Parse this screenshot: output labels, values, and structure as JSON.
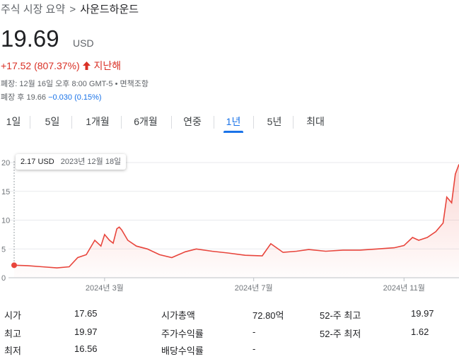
{
  "breadcrumb": {
    "root": "주식 시장 요약",
    "separator": ">",
    "current": "사운드하운드"
  },
  "quote": {
    "price": "19.69",
    "currency": "USD",
    "change": "+17.52 (807.37%)",
    "change_period": "지난해",
    "closed_note": "폐장: 12월 16일 오후 8:00 GMT-5",
    "disclaimer": "면책조항",
    "after_hours_label": "폐장 후 19.66",
    "after_hours_change": "−0.030 (0.15%)"
  },
  "tabs": [
    "1일",
    "5일",
    "1개월",
    "6개월",
    "연중",
    "1년",
    "5년",
    "최대"
  ],
  "active_tab": "1년",
  "tooltip": {
    "value": "2.17 USD",
    "date": "2023년 12월 18일"
  },
  "colors": {
    "up": "#d93025",
    "accent": "#1a73e8",
    "line": "#e8453c"
  },
  "chart_data": {
    "type": "area",
    "ylim": [
      0,
      20
    ],
    "yticks": [
      "0",
      "5",
      "10",
      "15",
      "20"
    ],
    "xticks": [
      "2024년 3월",
      "2024년 7월",
      "2024년 11월"
    ],
    "series": [
      {
        "x": [
          "2023-12-18",
          "2023-12-29",
          "2024-01-10",
          "2024-01-22",
          "2024-02-01",
          "2024-02-08",
          "2024-02-15",
          "2024-02-22",
          "2024-02-27",
          "2024-03-01",
          "2024-03-05",
          "2024-03-08",
          "2024-03-11",
          "2024-03-13",
          "2024-03-15",
          "2024-03-20",
          "2024-03-27",
          "2024-04-05",
          "2024-04-15",
          "2024-04-25",
          "2024-05-06",
          "2024-05-15",
          "2024-05-28",
          "2024-06-10",
          "2024-06-24",
          "2024-07-08",
          "2024-07-15",
          "2024-07-25",
          "2024-08-05",
          "2024-08-15",
          "2024-08-29",
          "2024-09-12",
          "2024-09-26",
          "2024-10-10",
          "2024-10-24",
          "2024-11-01",
          "2024-11-08",
          "2024-11-13",
          "2024-11-20",
          "2024-11-27",
          "2024-12-03",
          "2024-12-06",
          "2024-12-10",
          "2024-12-13",
          "2024-12-16"
        ],
        "values": [
          2.17,
          2.1,
          1.9,
          1.7,
          1.9,
          3.5,
          4.0,
          6.5,
          5.5,
          7.5,
          6.5,
          6.0,
          8.5,
          8.8,
          8.3,
          6.5,
          5.5,
          5.0,
          4.0,
          3.5,
          4.5,
          5.0,
          4.6,
          4.3,
          3.9,
          3.8,
          5.9,
          4.4,
          4.6,
          4.9,
          4.6,
          4.8,
          4.8,
          5.0,
          5.2,
          5.6,
          7.0,
          6.5,
          7.0,
          8.0,
          9.5,
          14.0,
          13.0,
          18.0,
          19.69
        ]
      }
    ]
  },
  "stats": [
    [
      {
        "label": "시가",
        "value": "17.65"
      },
      {
        "label": "시가총액",
        "value": "72.80억"
      },
      {
        "label": "52-주 최고",
        "value": "19.97"
      }
    ],
    [
      {
        "label": "최고",
        "value": "19.97"
      },
      {
        "label": "주가수익률",
        "value": "-"
      },
      {
        "label": "52-주 최저",
        "value": "1.62"
      }
    ],
    [
      {
        "label": "최저",
        "value": "16.56"
      },
      {
        "label": "배당수익률",
        "value": "-"
      }
    ]
  ]
}
